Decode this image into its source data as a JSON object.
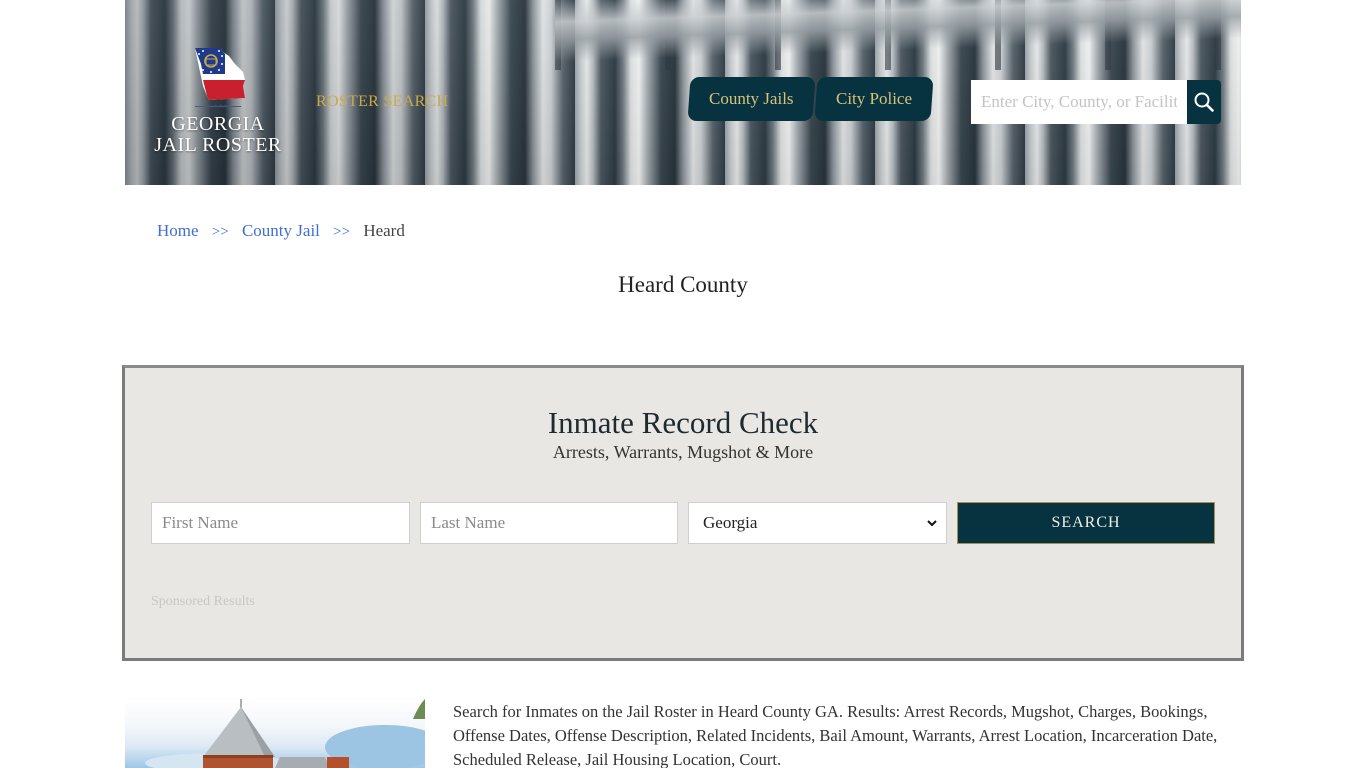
{
  "header": {
    "logo": {
      "line1": "GEORGIA",
      "line2": "JAIL ROSTER",
      "icon": "georgia-flag-map-icon"
    },
    "roster_search_label": "ROSTER SEARCH",
    "nav_tabs": [
      {
        "label": "County Jails"
      },
      {
        "label": "City Police"
      }
    ],
    "search": {
      "placeholder": "Enter City, County, or Facility",
      "value": "",
      "icon": "search-icon"
    },
    "colors": {
      "nav_bg": "#06333f",
      "nav_text": "#d7c27a",
      "roster_search": "#c9a94a"
    }
  },
  "breadcrumb": {
    "items": [
      {
        "label": "Home"
      },
      {
        "label": "County Jail"
      },
      {
        "label": "Heard"
      }
    ],
    "separator": ">>"
  },
  "page_title": "Heard County",
  "record_check": {
    "title": "Inmate Record Check",
    "subtitle": "Arrests, Warrants, Mugshot & More",
    "first_name": {
      "placeholder": "First Name",
      "value": ""
    },
    "last_name": {
      "placeholder": "Last Name",
      "value": ""
    },
    "state": {
      "selected": "Georgia"
    },
    "search_button": "SEARCH",
    "sponsored_label": "Sponsored Results",
    "colors": {
      "panel_bg": "#e8e7e3",
      "button_bg": "#06333f"
    }
  },
  "content": {
    "image_alt": "Heard County jail building",
    "intro": "Search for Inmates on the Jail Roster in Heard County GA. Results: Arrest Records, Mugshot, Charges, Bookings, Offense Dates, Offense Description, Related Incidents, Bail Amount, Warrants, Arrest Location, Incarceration Date, Scheduled Release, Jail Housing Location, Court."
  }
}
